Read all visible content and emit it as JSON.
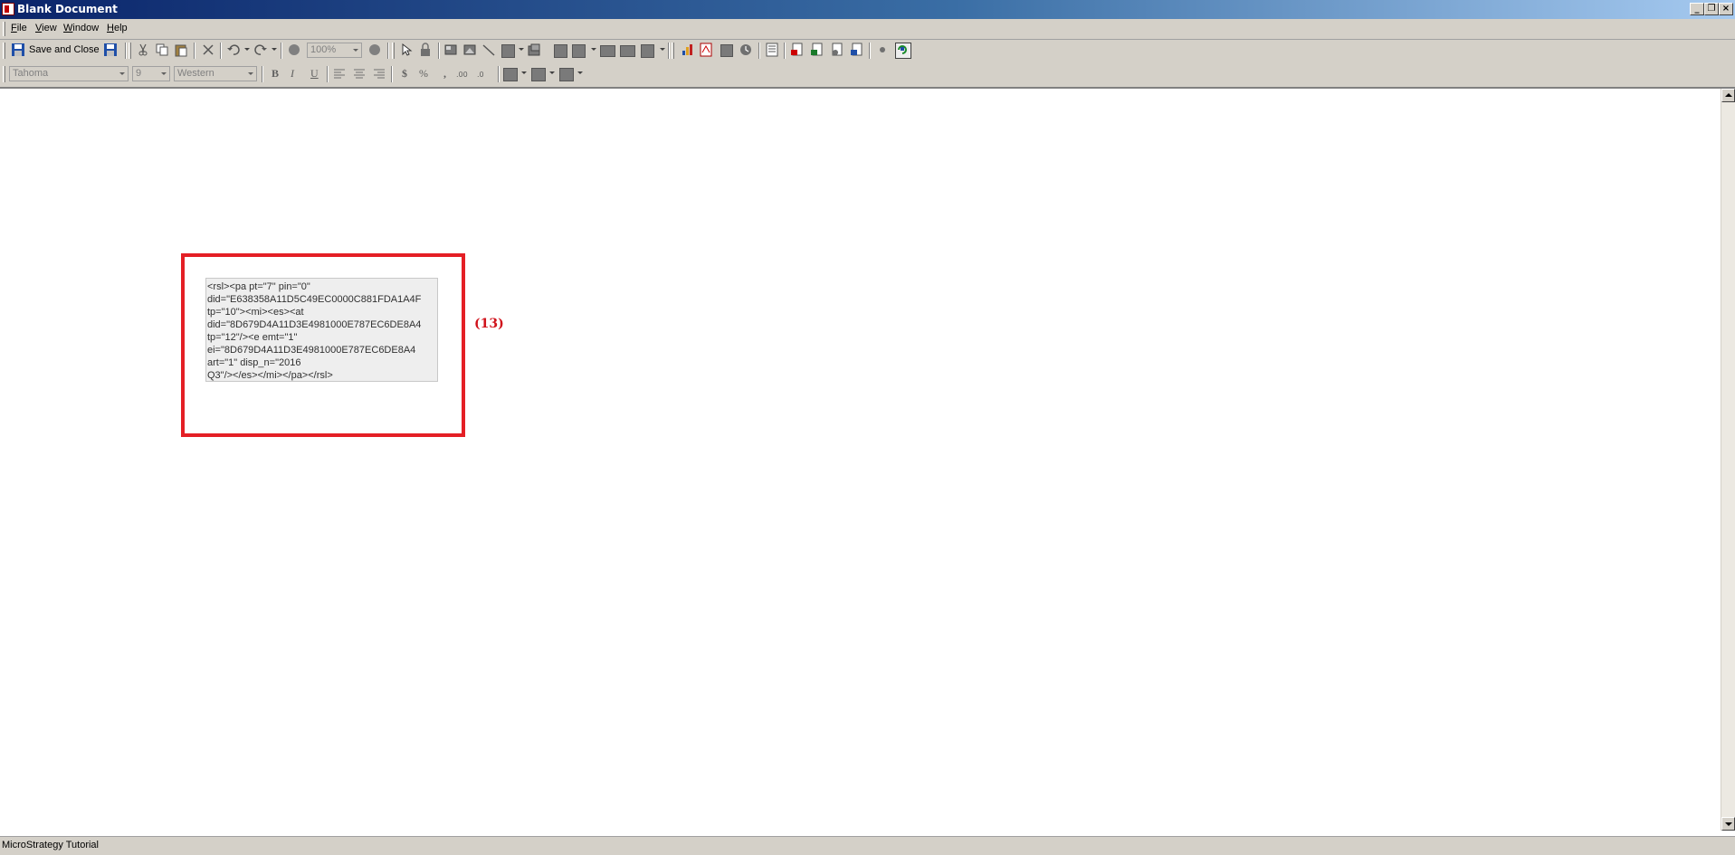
{
  "window": {
    "title": "Blank Document",
    "controls": [
      "minimize",
      "restore",
      "close"
    ]
  },
  "menubar": {
    "items": [
      {
        "label": "File",
        "accel": "F"
      },
      {
        "label": "View",
        "accel": "V"
      },
      {
        "label": "Window",
        "accel": "W"
      },
      {
        "label": "Help",
        "accel": "H"
      }
    ]
  },
  "toolbar": {
    "save_and_close_label": "Save and Close",
    "zoom_value": "100%"
  },
  "format_toolbar": {
    "font_name": "Tahoma",
    "font_size": "9",
    "script": "Western",
    "bold": "B",
    "italic": "I",
    "underline": "U",
    "currency": "$",
    "percent": "%",
    "comma": ","
  },
  "document": {
    "textfield_lines": [
      "<rsl><pa pt=\"7\" pin=\"0\"",
      "did=\"E638358A11D5C49EC0000C881FDA1A4F",
      "tp=\"10\"><mi><es><at",
      "did=\"8D679D4A11D3E4981000E787EC6DE8A4",
      "tp=\"12\"/><e emt=\"1\"",
      "ei=\"8D679D4A11D3E4981000E787EC6DE8A4",
      "art=\"1\" disp_n=\"2016",
      "Q3\"/></es></mi></pa></rsl>"
    ],
    "callout_label": "(13)",
    "highlight_color": "#e41f25"
  },
  "statusbar": {
    "text": "MicroStrategy Tutorial"
  },
  "colors": {
    "titlebar_start": "#0a246a",
    "titlebar_end": "#a6caf0",
    "chrome": "#d4d0c8"
  }
}
